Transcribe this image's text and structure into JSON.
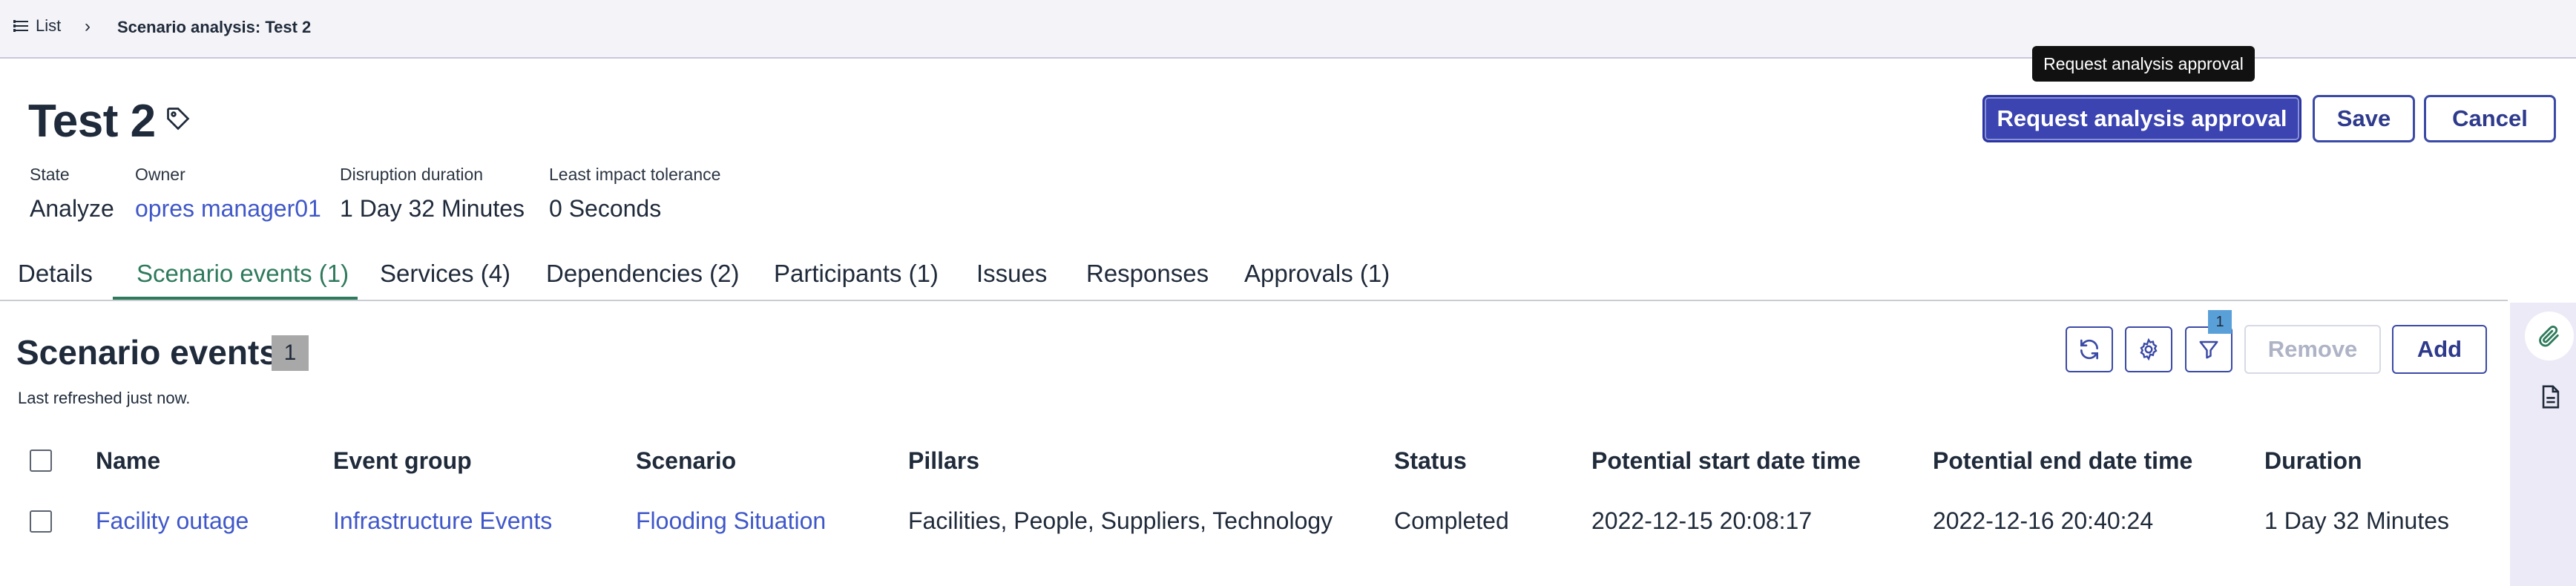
{
  "breadcrumb": {
    "list_label": "List",
    "current": "Scenario analysis: Test 2"
  },
  "record": {
    "title": "Test 2",
    "tag_icon": "tag-icon"
  },
  "tooltip": "Request analysis approval",
  "actions": {
    "request_approval": "Request analysis approval",
    "save": "Save",
    "cancel": "Cancel"
  },
  "meta": [
    {
      "label": "State",
      "value": "Analyze"
    },
    {
      "label": "Owner",
      "value": "opres manager01"
    },
    {
      "label": "Disruption duration",
      "value": "1 Day 32 Minutes"
    },
    {
      "label": "Least impact tolerance",
      "value": "0 Seconds"
    }
  ],
  "tabs": [
    {
      "label": "Details"
    },
    {
      "label": "Scenario events (1)"
    },
    {
      "label": "Services (4)"
    },
    {
      "label": "Dependencies (2)"
    },
    {
      "label": "Participants (1)"
    },
    {
      "label": "Issues"
    },
    {
      "label": "Responses"
    },
    {
      "label": "Approvals (1)"
    }
  ],
  "active_tab": "Scenario events (1)",
  "section": {
    "title": "Scenario events",
    "count": "1",
    "refreshed": "Last refreshed just now.",
    "filter_count": "1",
    "remove": "Remove",
    "add": "Add"
  },
  "table": {
    "columns": [
      "Name",
      "Event group",
      "Scenario",
      "Pillars",
      "Status",
      "Potential start date time",
      "Potential end date time",
      "Duration"
    ],
    "rows": [
      [
        "Facility outage",
        "Infrastructure Events",
        "Flooding Situation",
        "Facilities, People, Suppliers, Technology",
        "Completed",
        "2022-12-15 20:08:17",
        "2022-12-16 20:40:24",
        "1 Day 32 Minutes"
      ]
    ]
  },
  "colors": {
    "accent": "#3b44b0",
    "link": "#3f57c9",
    "active_tab": "#2e7a5c",
    "rail": "#eceaf7"
  }
}
